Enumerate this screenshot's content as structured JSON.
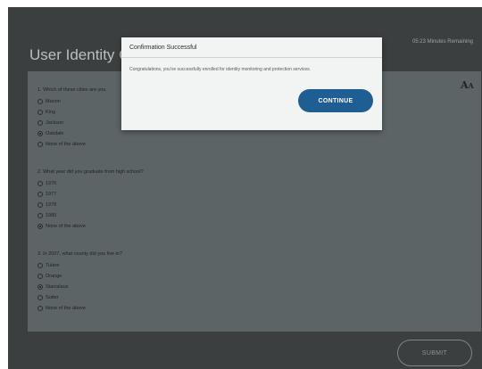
{
  "header": {
    "title": "User Identity Co",
    "timer": "05:23 Minutes Remaining"
  },
  "panel": {
    "font_icon": "font-size-icon",
    "questions": [
      {
        "text": "1. Which of these cities are you",
        "options": [
          {
            "label": "Marion",
            "selected": false
          },
          {
            "label": "King",
            "selected": false
          },
          {
            "label": "Jackson",
            "selected": false
          },
          {
            "label": "Oakdale",
            "selected": true
          },
          {
            "label": "None of the above",
            "selected": false
          }
        ]
      },
      {
        "text": "2. What year did you graduate from high school?",
        "options": [
          {
            "label": "1976",
            "selected": false
          },
          {
            "label": "1977",
            "selected": false
          },
          {
            "label": "1978",
            "selected": false
          },
          {
            "label": "1980",
            "selected": false
          },
          {
            "label": "None of the above",
            "selected": true
          }
        ]
      },
      {
        "text": "3. In 2007, what county did you live in?",
        "options": [
          {
            "label": "Tulare",
            "selected": false
          },
          {
            "label": "Orange",
            "selected": false
          },
          {
            "label": "Stanislaus",
            "selected": true
          },
          {
            "label": "Sutter",
            "selected": false
          },
          {
            "label": "None of the above",
            "selected": false
          }
        ]
      }
    ]
  },
  "submit_label": "SUBMIT",
  "modal": {
    "title": "Confirmation Successful",
    "message": "Congratulations, you've successfully enrolled for identity monitoring and protection services.",
    "continue_label": "CONTINUE"
  }
}
